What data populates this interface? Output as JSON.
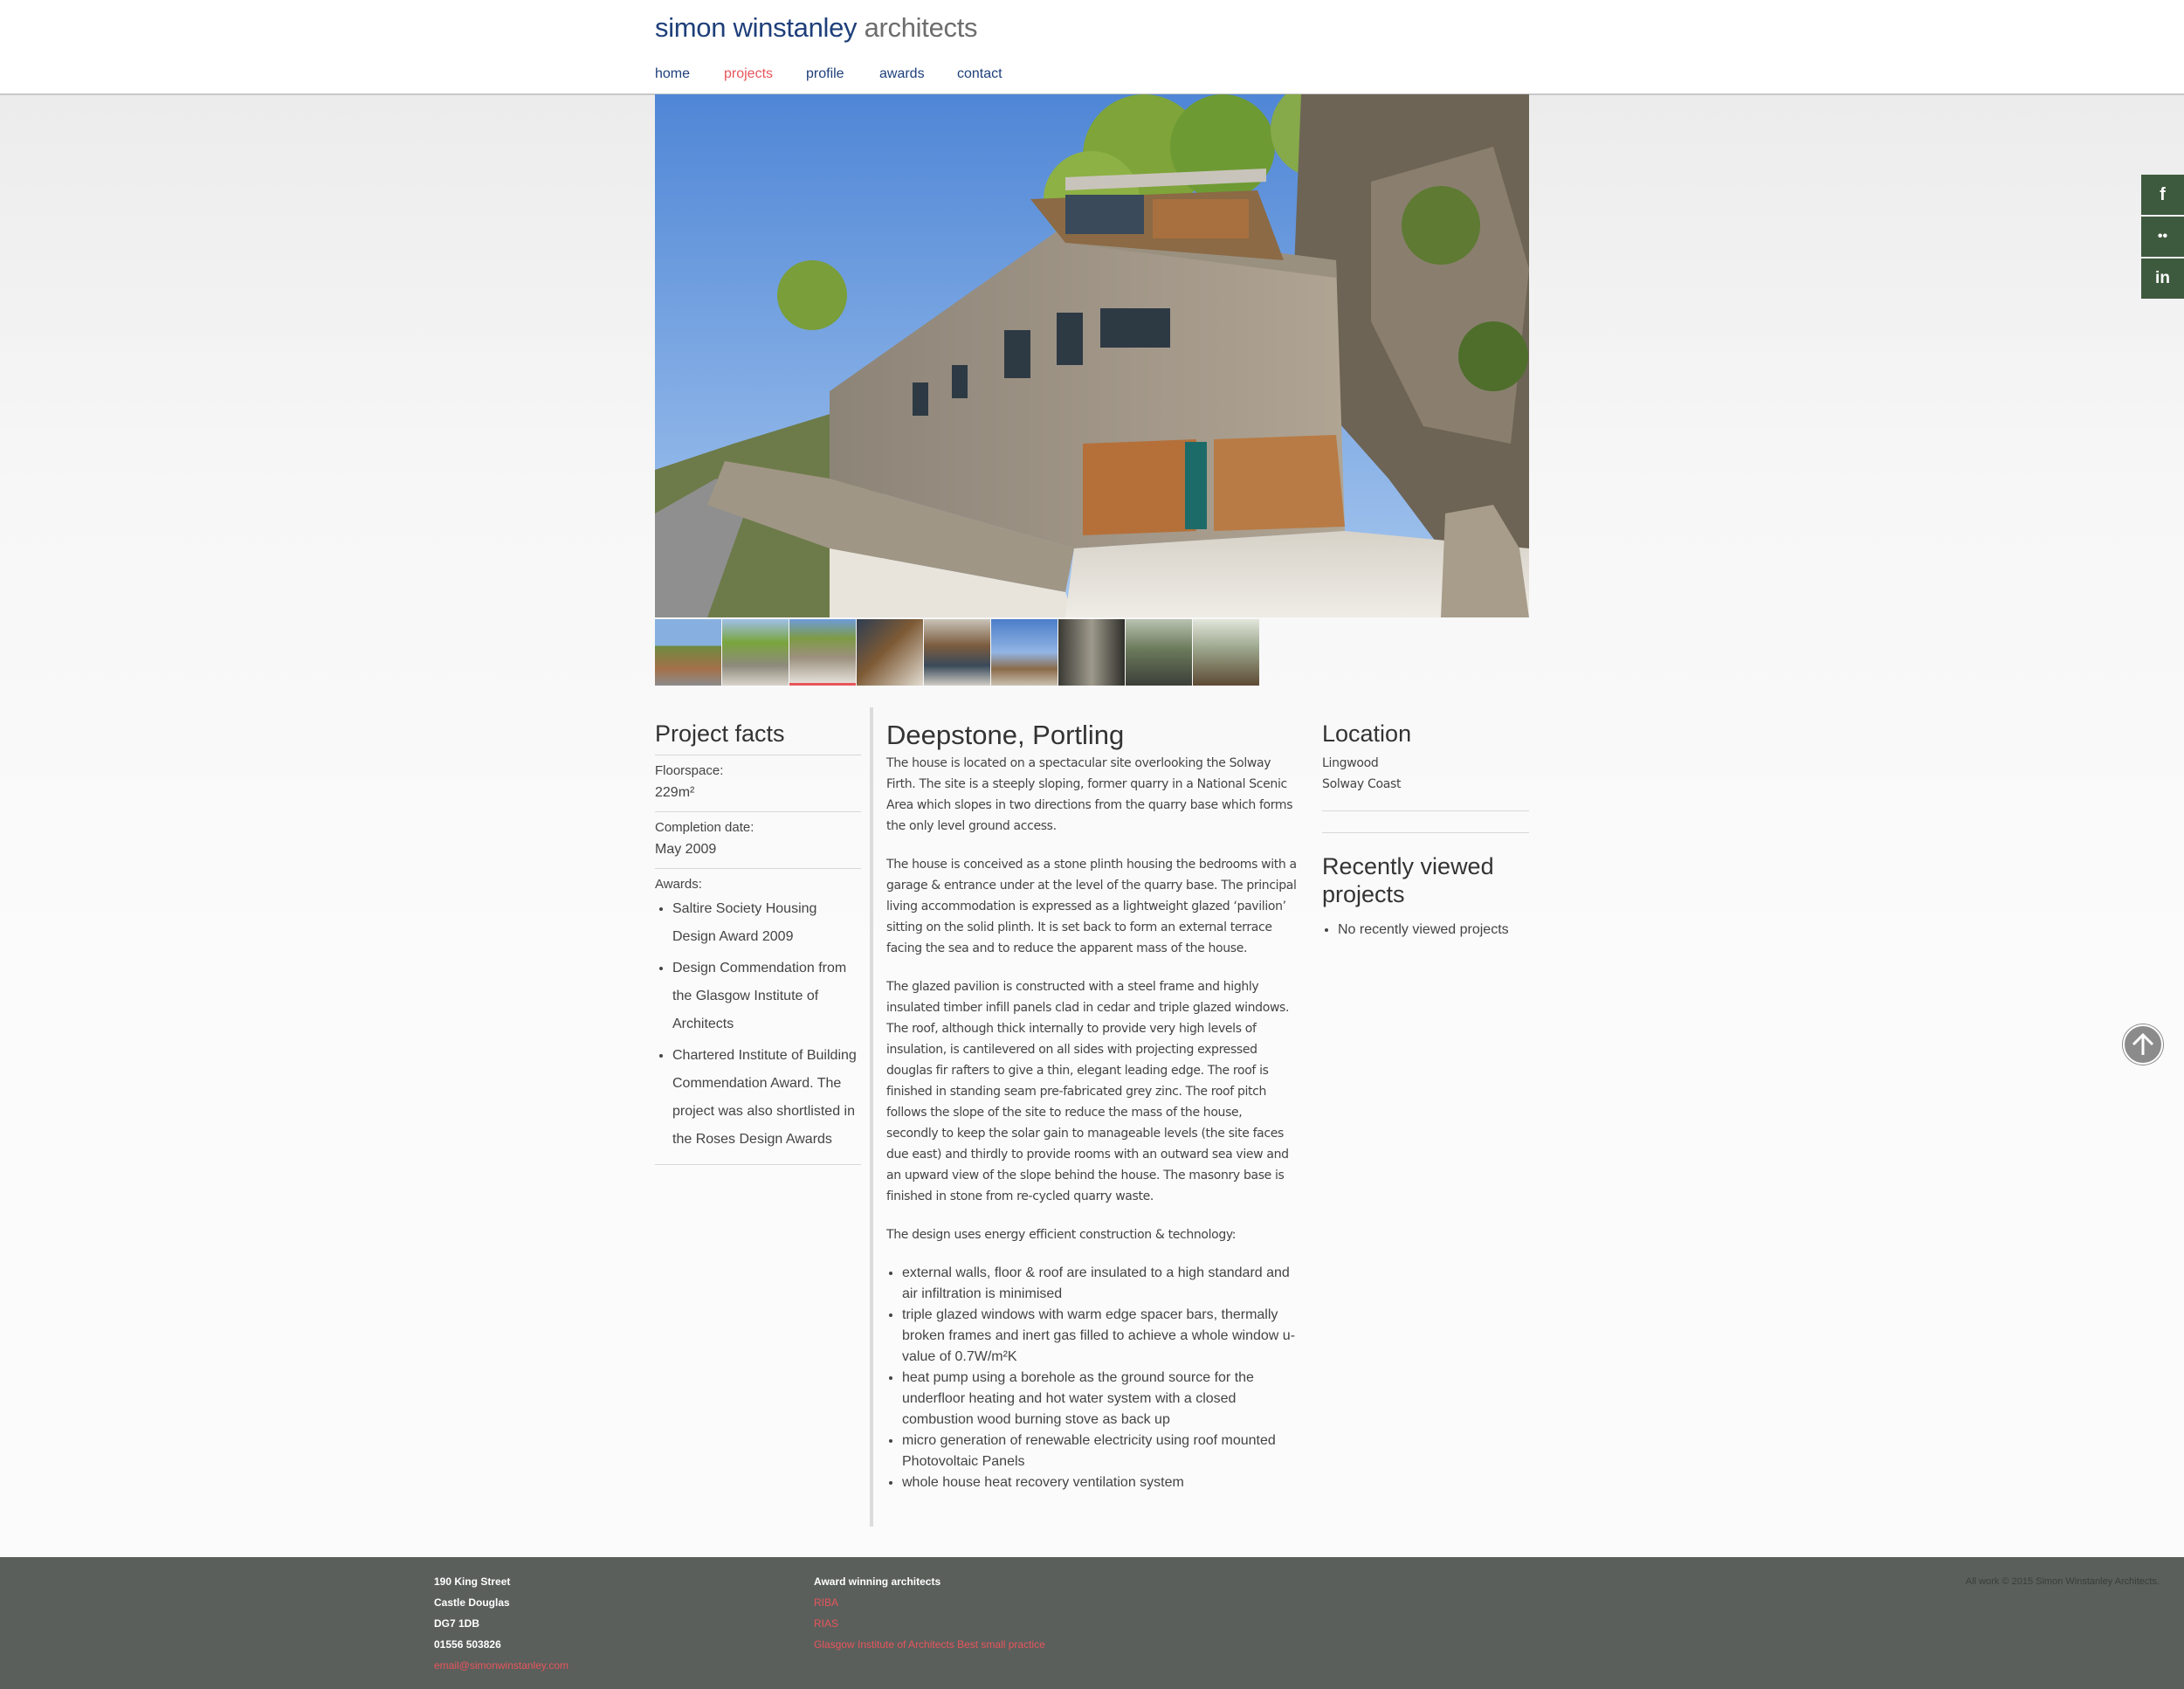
{
  "site": {
    "logo_primary": "simon winstanley",
    "logo_secondary": "architects",
    "nav": [
      {
        "label": "home",
        "active": false
      },
      {
        "label": "projects",
        "active": true
      },
      {
        "label": "profile",
        "active": false
      },
      {
        "label": "awards",
        "active": false
      },
      {
        "label": "contact",
        "active": false
      }
    ]
  },
  "gallery": {
    "thumbnail_count": 9,
    "selected_index": 2
  },
  "project_facts": {
    "heading": "Project facts",
    "floorspace_label": "Floorspace:",
    "floorspace_value": "229m²",
    "completion_label": "Completion date:",
    "completion_value": "May 2009",
    "awards_label": "Awards:",
    "awards": [
      "Saltire Society Housing Design Award 2009",
      "Design Commendation from the Glasgow Institute of Architects",
      "Chartered Institute of Building Commendation Award. The project was also shortlisted in the Roses Design Awards"
    ]
  },
  "project": {
    "title": "Deepstone, Portling",
    "paragraphs": [
      "The house is located on a spectacular site overlooking the Solway Firth. The site is a steeply sloping, former quarry in a National Scenic Area which slopes in two directions from the quarry base which forms the only level ground access.",
      "The house is conceived as a stone plinth housing the bedrooms with a garage & entrance under at the level of the quarry base. The principal living accommodation is expressed as a lightweight glazed ‘pavilion’ sitting on the solid plinth. It is set back to form an external terrace facing the sea and to reduce the apparent mass of the house.",
      "The glazed pavilion is constructed with a steel frame and highly insulated timber infill panels clad in cedar and triple glazed windows. The roof, although thick internally to provide very high levels of insulation, is cantilevered on all sides with projecting expressed douglas fir rafters to give a thin, elegant leading edge. The roof is finished in standing seam pre-fabricated grey zinc. The roof pitch follows the slope of the site to reduce the mass of the house, secondly to keep the solar gain to manageable levels (the site faces due east) and thirdly to provide rooms with an outward sea view and an upward view of the slope behind the house. The masonry base is finished in stone from re-cycled quarry waste.",
      "The design uses energy efficient construction & technology:"
    ],
    "features": [
      "external walls, floor & roof are insulated to a high standard and air infiltration is minimised",
      "triple glazed windows with warm edge spacer bars, thermally broken frames and inert gas filled to achieve a whole window u-value of 0.7W/m²K",
      "heat pump using a borehole as the ground source for the underfloor heating and hot water system with a closed combustion wood burning stove as back up",
      "micro generation of renewable electricity using roof mounted Photovoltaic Panels",
      "whole house heat recovery ventilation system"
    ]
  },
  "location": {
    "heading": "Location",
    "line1": "Lingwood",
    "line2": "Solway Coast"
  },
  "recently_viewed": {
    "heading": "Recently viewed projects",
    "items": [
      "No recently viewed projects"
    ]
  },
  "social": [
    {
      "icon": "facebook-icon",
      "glyph": "f"
    },
    {
      "icon": "flickr-icon",
      "glyph": "••"
    },
    {
      "icon": "linkedin-icon",
      "glyph": "in"
    }
  ],
  "footer": {
    "address": [
      "190 King Street",
      "Castle Douglas",
      "DG7 1DB",
      "01556 503826"
    ],
    "email": "email@simonwinstanley.com",
    "awards_heading": "Award winning architects",
    "award_links": [
      "RIBA",
      "RIAS",
      "Glasgow Institute of Architects Best small practice"
    ],
    "copyright": "All work © 2015 Simon Winstanley Architects."
  },
  "colors": {
    "brand_blue": "#1e3f7a",
    "accent_red": "#e8555b",
    "social_green": "#3e5a3e",
    "footer_grey": "#5a5f5c"
  }
}
